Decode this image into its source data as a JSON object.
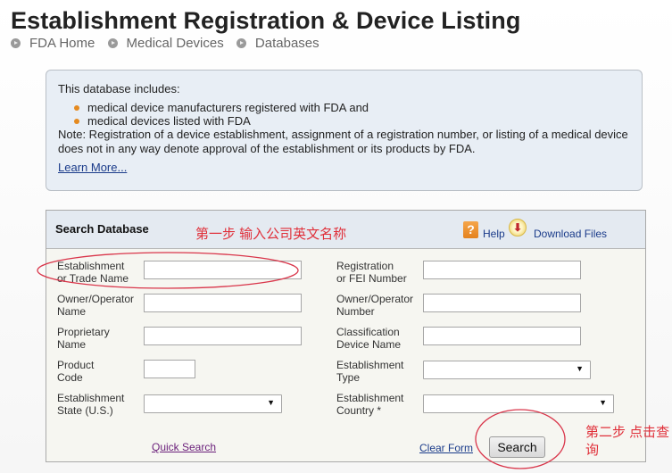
{
  "header": {
    "title": "Establishment Registration & Device Listing",
    "breadcrumb": [
      "FDA Home",
      "Medical Devices",
      "Databases"
    ]
  },
  "info": {
    "intro": "This database includes:",
    "bullets": [
      "medical device manufacturers registered with FDA and",
      "medical devices listed with FDA"
    ],
    "note": "Note: Registration of a device establishment, assignment of a registration number, or listing of a medical device does not in any way denote approval of the establishment or its products by FDA.",
    "learn_more": "Learn More..."
  },
  "search": {
    "title": "Search Database",
    "help": "Help",
    "download": "Download Files",
    "fields": {
      "establishment_name": {
        "label1": "Establishment",
        "label2": "or Trade Name",
        "value": ""
      },
      "registration_number": {
        "label1": "Registration",
        "label2": "or FEI Number",
        "value": ""
      },
      "owner_operator_name": {
        "label1": "Owner/Operator",
        "label2": "Name",
        "value": ""
      },
      "owner_operator_number": {
        "label1": "Owner/Operator",
        "label2": "Number",
        "value": ""
      },
      "proprietary_name": {
        "label1": "Proprietary",
        "label2": "Name",
        "value": ""
      },
      "classification_device_name": {
        "label1": "Classification",
        "label2": "Device Name",
        "value": ""
      },
      "product_code": {
        "label1": "Product",
        "label2": "Code",
        "value": ""
      },
      "establishment_type": {
        "label1": "Establishment",
        "label2": "Type",
        "selected": ""
      },
      "establishment_state": {
        "label1": "Establishment",
        "label2": "State (U.S.)",
        "selected": ""
      },
      "establishment_country": {
        "label1": "Establishment",
        "label2": "Country *",
        "selected": ""
      }
    },
    "quick_search": "Quick Search",
    "clear_form": "Clear Form",
    "search_button": "Search"
  },
  "annotations": {
    "step1": "第一步 输入公司英文名称",
    "step2": "第二步 点击查询",
    "color": "#e0303a"
  },
  "colors": {
    "info_bg": "#e8eef5",
    "panel_bg": "#f6f6f1",
    "panel_header_bg": "#e4eaf1",
    "bullet": "#e58a1f",
    "link": "#1a3b8a"
  }
}
